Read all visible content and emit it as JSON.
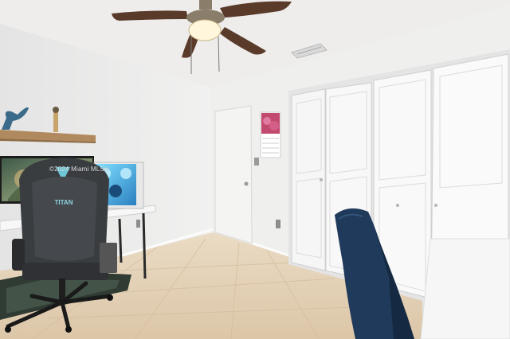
{
  "photo": {
    "watermark": "©2024 Miami MLS®",
    "chair_brand": "TITAN",
    "palette": {
      "ceiling": "#ecebea",
      "wall_left": "#ebeaea",
      "wall_right": "#eeeeed",
      "floor_tile": "#e6d3b8",
      "door_white": "#f2f2f2",
      "chair_fabric": "#3a3d40",
      "office_chair_blue": "#1f3a5a"
    }
  }
}
